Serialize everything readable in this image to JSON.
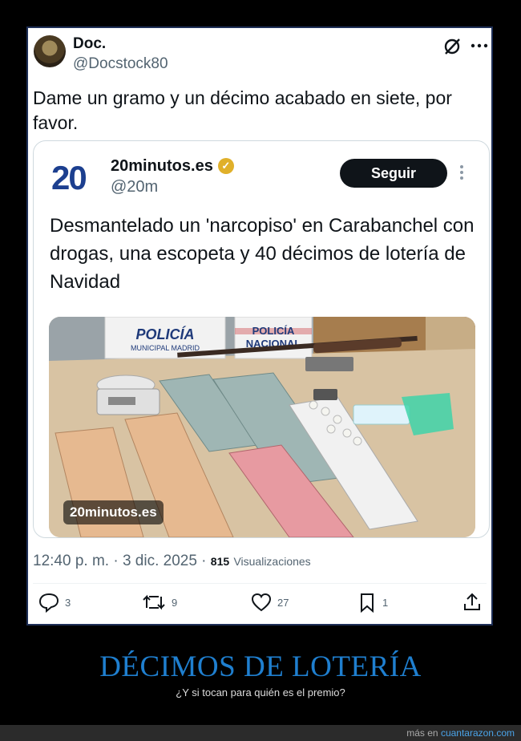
{
  "tweet": {
    "name": "Doc.",
    "handle": "@Docstock80",
    "text": "Dame un gramo y un décimo acabado en siete, por favor.",
    "time": "12:40 p. m. · 3 dic. 2025 ·",
    "views_count": "815",
    "views_label": "Visualizaciones"
  },
  "quote": {
    "logo": "20",
    "name": "20minutos.es",
    "verified_mark": "✓",
    "handle": "@20m",
    "follow_label": "Seguir",
    "text": "Desmantelado un 'narcopiso' en Carabanchel con drogas, una escopeta y 40 décimos de lotería de Navidad",
    "photo_badge": "20minutos.es",
    "photo_sign_left_1": "POLICÍA",
    "photo_sign_left_2": "MUNICIPAL MADRID",
    "photo_sign_right_1": "POLICÍA",
    "photo_sign_right_2": "NACIONAL"
  },
  "actions": {
    "replies": "3",
    "retweets": "9",
    "likes": "27",
    "bookmarks": "1"
  },
  "caption": {
    "title": "DÉCIMOS DE LOTERÍA",
    "subtitle": "¿Y si tocan para quién es el premio?"
  },
  "footer": {
    "prefix": "más en ",
    "site": "cuantarazon.com"
  },
  "icons": [
    "grok-icon",
    "more-icon",
    "verified-icon",
    "kebab-icon",
    "reply-icon",
    "retweet-icon",
    "like-icon",
    "bookmark-icon",
    "share-icon"
  ],
  "colors": {
    "accent": "#1f7fcf",
    "logo_blue": "#1c3f8f",
    "badge_gold": "#e0b02a"
  }
}
